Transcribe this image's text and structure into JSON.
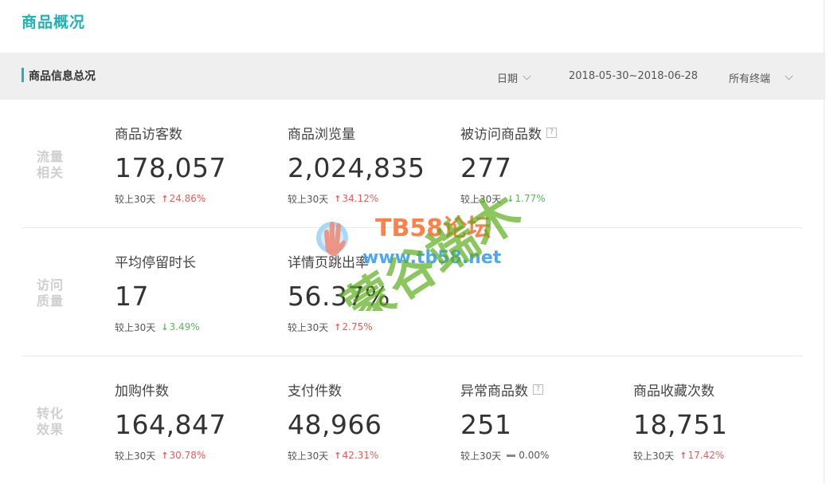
{
  "page_title": "商品概况",
  "section": {
    "title": "商品信息总况",
    "date_label": "日期",
    "date_range": "2018-05-30~2018-06-28",
    "terminal": "所有终端"
  },
  "compare_label": "较上30天",
  "rows": [
    {
      "label_line1": "流量",
      "label_line2": "相关",
      "metrics": [
        {
          "name": "商品访客数",
          "value": "178,057",
          "change": "24.86%",
          "direction": "up"
        },
        {
          "name": "商品浏览量",
          "value": "2,024,835",
          "change": "34.12%",
          "direction": "up"
        },
        {
          "name": "被访问商品数",
          "value": "277",
          "change": "1.77%",
          "direction": "down",
          "help": true
        }
      ]
    },
    {
      "label_line1": "访问",
      "label_line2": "质量",
      "metrics": [
        {
          "name": "平均停留时长",
          "value": "17",
          "change": "3.49%",
          "direction": "down"
        },
        {
          "name": "详情页跳出率",
          "value": "56.37%",
          "change": "2.75%",
          "direction": "up"
        }
      ]
    },
    {
      "label_line1": "转化",
      "label_line2": "效果",
      "metrics": [
        {
          "name": "加购件数",
          "value": "164,847",
          "change": "30.78%",
          "direction": "up"
        },
        {
          "name": "支付件数",
          "value": "48,966",
          "change": "42.31%",
          "direction": "up"
        },
        {
          "name": "异常商品数",
          "value": "251",
          "change": "0.00%",
          "direction": "flat",
          "help": true
        },
        {
          "name": "商品收藏次数",
          "value": "18,751",
          "change": "17.42%",
          "direction": "up"
        }
      ]
    }
  ],
  "watermark": {
    "brand": "TB58论坛",
    "url": "www.tb58.net",
    "overlay": "蒙谷端木"
  },
  "colors": {
    "accent": "#1fb3b6",
    "up": "#f25a55",
    "down": "#5cb85c",
    "watermark_green": "#5cae1b",
    "watermark_orange": "#ff6a2a",
    "watermark_blue": "#3b9ff0"
  }
}
